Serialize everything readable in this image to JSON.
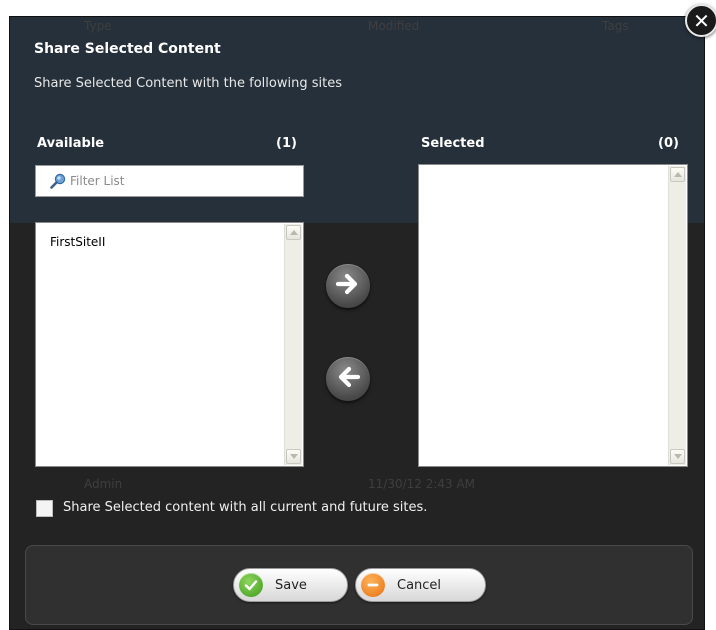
{
  "dialog": {
    "title": "Share Selected Content",
    "subtitle": "Share Selected Content with the following sites"
  },
  "available": {
    "header": "Available",
    "count": "(1)",
    "filter_placeholder": "Filter List",
    "items": [
      "FirstSiteII"
    ]
  },
  "selected": {
    "header": "Selected",
    "count": "(0)",
    "items": []
  },
  "share_all": {
    "label": "Share Selected content with all current and future sites.",
    "checked": false
  },
  "actions": {
    "save_label": "Save",
    "cancel_label": "Cancel"
  },
  "background": {
    "header": [
      "Type",
      "Modified",
      "Tags"
    ],
    "rows": [
      "Admin",
      "11/30/12 2:43 AM"
    ]
  },
  "icons": {
    "close": "close-icon",
    "search": "search-icon",
    "move_right": "arrow-right-icon",
    "move_left": "arrow-left-icon",
    "save": "check-icon",
    "cancel": "minus-icon"
  },
  "colors": {
    "dialog_bg": "#232323",
    "footer_bg": "#303030",
    "save_icon": "#5bb534",
    "cancel_icon": "#f08a22"
  }
}
